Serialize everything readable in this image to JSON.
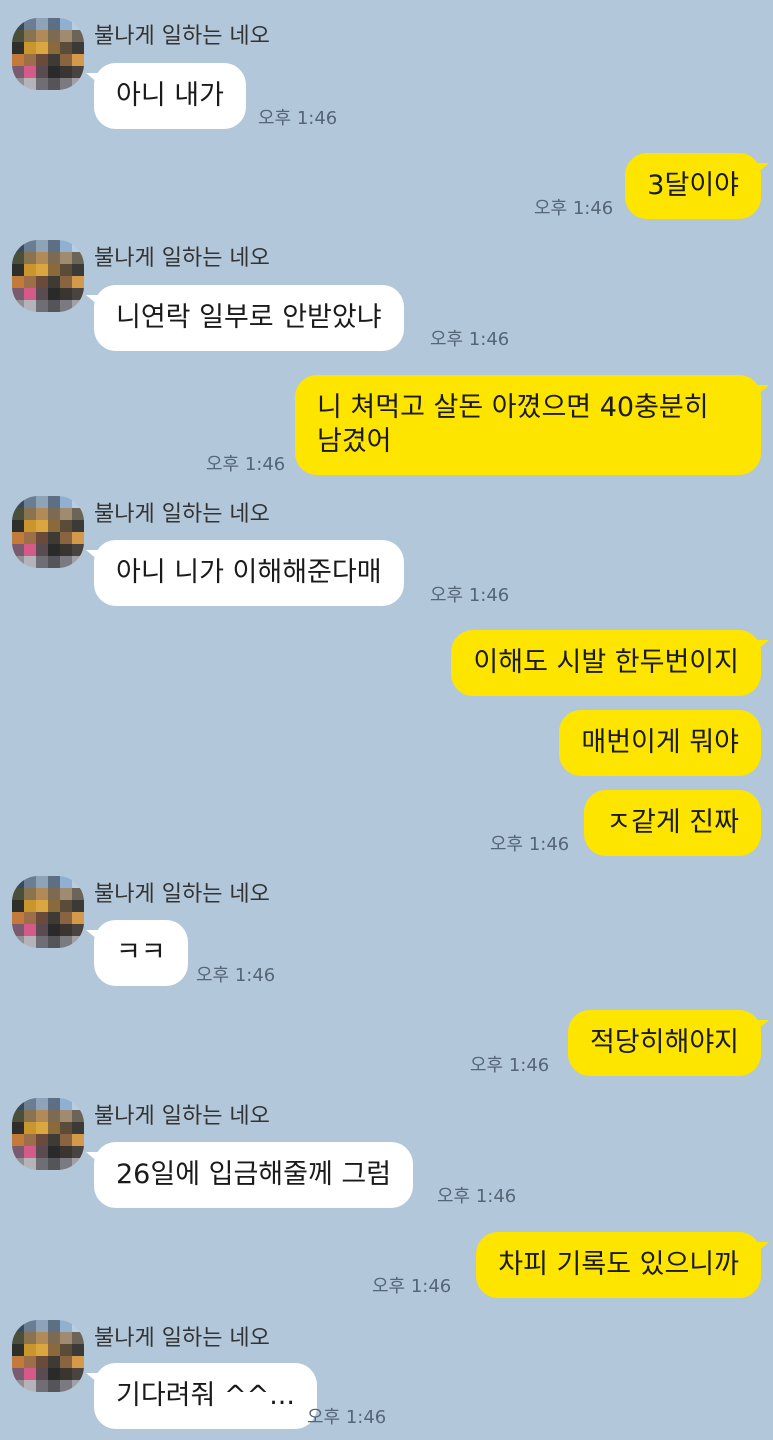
{
  "contact_name": "불나게 일하는 네오",
  "avatar_icon": "pixelated-profile-avatar",
  "colors": {
    "background": "#b2c7d9",
    "incoming_bubble": "#ffffff",
    "outgoing_bubble": "#fee500",
    "timestamp": "#556677"
  },
  "messages": [
    {
      "sender": "other",
      "text": "아니 내가",
      "time": "오후 1:46"
    },
    {
      "sender": "me",
      "text": "3달이야",
      "time": "오후 1:46"
    },
    {
      "sender": "other",
      "text": "니연락 일부로 안받았냐",
      "time": "오후 1:46"
    },
    {
      "sender": "me",
      "text": "니 쳐먹고 살돈 아꼈으면 40충분히 남겼어",
      "time": "오후 1:46"
    },
    {
      "sender": "other",
      "text": "아니 니가 이해해준다매",
      "time": "오후 1:46"
    },
    {
      "sender": "me",
      "text": "이해도 시발 한두번이지",
      "time": ""
    },
    {
      "sender": "me",
      "text": "매번이게 뭐야",
      "time": ""
    },
    {
      "sender": "me",
      "text": "ㅈ같게 진짜",
      "time": "오후 1:46"
    },
    {
      "sender": "other",
      "text": "ㅋㅋ",
      "time": "오후 1:46"
    },
    {
      "sender": "me",
      "text": "적당히해야지",
      "time": "오후 1:46"
    },
    {
      "sender": "other",
      "text": "26일에 입금해줄께 그럼",
      "time": "오후 1:46"
    },
    {
      "sender": "me",
      "text": "차피 기록도 있으니까",
      "time": "오후 1:46"
    },
    {
      "sender": "other",
      "text": "기다려줘 ^^...",
      "time": "오후 1:46"
    }
  ]
}
